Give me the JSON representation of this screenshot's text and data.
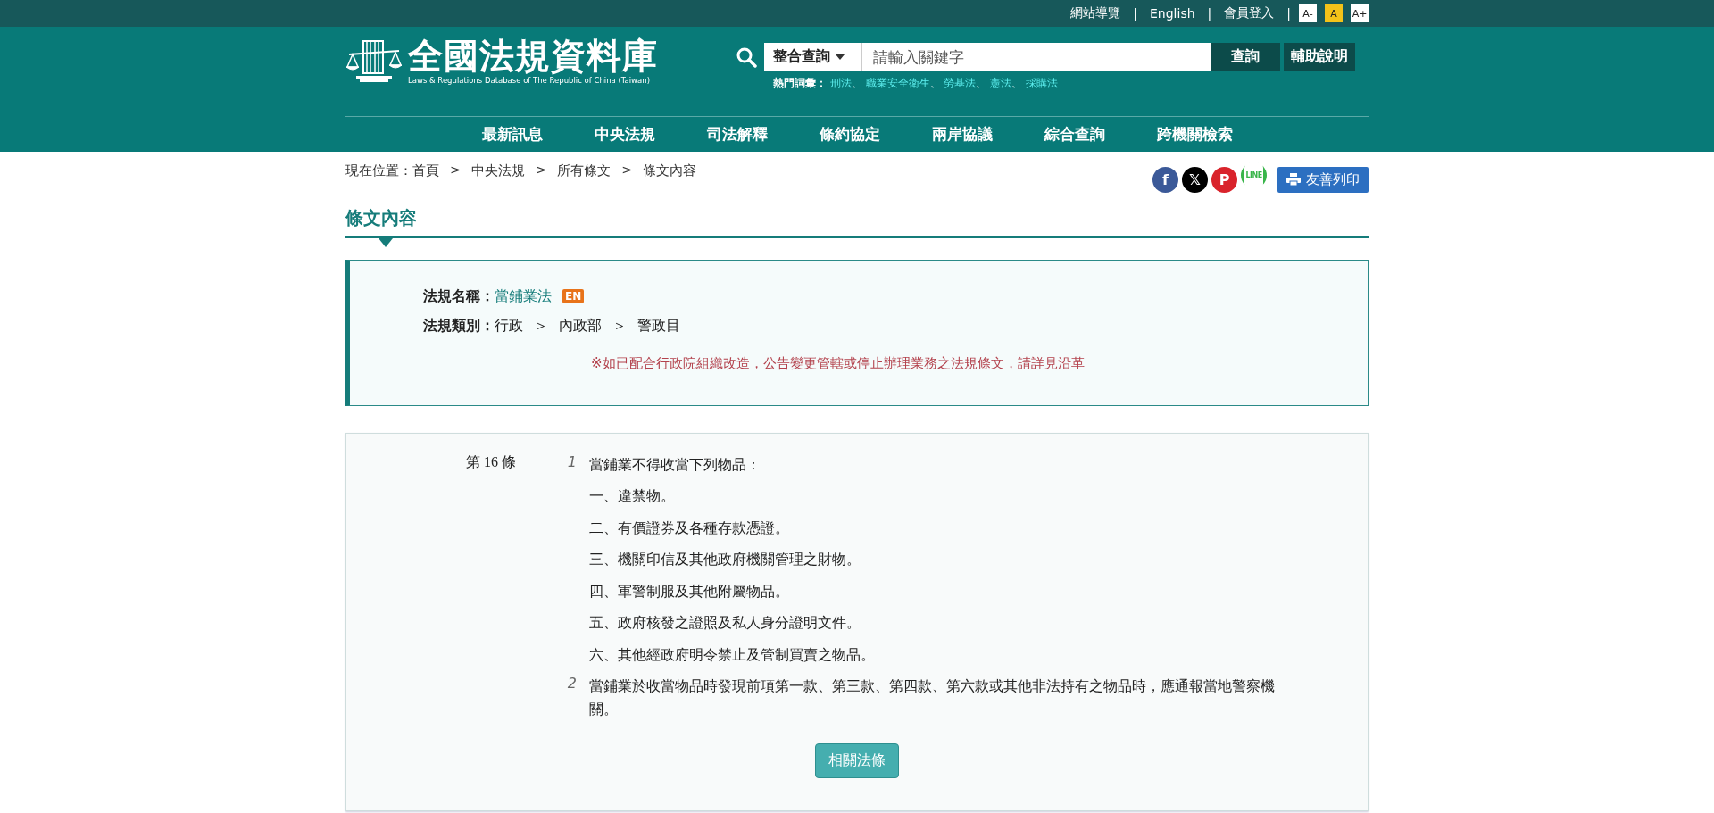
{
  "top_bar": {
    "links": [
      "網站導覽",
      "English",
      "會員登入"
    ],
    "separator": "|",
    "font_sizes": [
      {
        "label": "A-",
        "selected": false
      },
      {
        "label": "A",
        "selected": true
      },
      {
        "label": "A+",
        "selected": false
      }
    ]
  },
  "logo": {
    "title": "全國法規資料庫",
    "subtitle": "Laws & Regulations Database of The Republic of China (Taiwan)"
  },
  "search": {
    "scope": "整合查詢",
    "placeholder": "請輸入關鍵字",
    "button": "查詢",
    "help": "輔助說明",
    "hot_label": "熱門詞彙：",
    "hot_terms": [
      "刑法",
      "職業安全衛生",
      "勞基法",
      "憲法",
      "採購法"
    ],
    "hot_separator": "、"
  },
  "nav": [
    "最新訊息",
    "中央法規",
    "司法解釋",
    "條約協定",
    "兩岸協議",
    "綜合查詢",
    "跨機關檢索"
  ],
  "breadcrumb": {
    "label": "現在位置：",
    "items": [
      "首頁",
      "中央法規",
      "所有條文",
      "條文內容"
    ],
    "separator": ">"
  },
  "share": {
    "icons": [
      {
        "kind": "facebook",
        "text": "f",
        "color": "#3b5998"
      },
      {
        "kind": "x",
        "text": "𝕏",
        "color": "#000000"
      },
      {
        "kind": "pinterest",
        "text": "P",
        "color": "#d9232b"
      },
      {
        "kind": "line",
        "text": "LINE",
        "color": "#39b54a"
      }
    ],
    "print": "友善列印"
  },
  "page_title": "條文內容",
  "info": {
    "name_label": "法規名稱：",
    "name": "當鋪業法",
    "en_badge": "EN",
    "category_label": "法規類別：",
    "category": [
      "行政",
      "內政部",
      "警政目"
    ],
    "category_separator": "＞",
    "notice": "※如已配合行政院組織改造，公告變更管轄或停止辦理業務之法規條文，請詳見沿革"
  },
  "article": {
    "number": "第 16 條",
    "paragraphs": [
      {
        "number": "1",
        "lines": [
          "當鋪業不得收當下列物品：",
          "一、違禁物。",
          "二、有價證券及各種存款憑證。",
          "三、機關印信及其他政府機關管理之財物。",
          "四、軍警制服及其他附屬物品。",
          "五、政府核發之證照及私人身分證明文件。",
          "六、其他經政府明令禁止及管制買賣之物品。"
        ]
      },
      {
        "number": "2",
        "lines": [
          "當鋪業於收當物品時發現前項第一款、第三款、第四款、第六款或其他非法持有之物品時，應通報當地警察機關。"
        ]
      }
    ],
    "related_button": "相關法條"
  }
}
